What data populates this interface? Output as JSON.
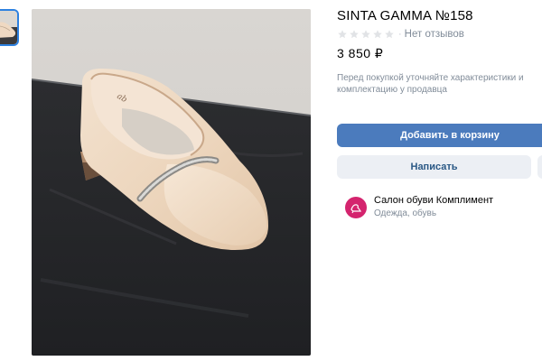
{
  "product": {
    "title": "SINTA GAMMA №158",
    "reviews_text": "Нет отзывов",
    "rating_stars_filled": 0,
    "rating_stars_total": 5,
    "price": "3 850 ₽",
    "note": "Перед покупкой уточняйте характеристики и комплектацию у продавца"
  },
  "actions": {
    "add_to_cart": "Добавить в корзину",
    "message": "Написать"
  },
  "seller": {
    "name": "Салон обуви Комплимент",
    "category": "Одежда, обувь"
  },
  "colors": {
    "accent": "#4b7bbd",
    "secondary_bg": "#eceff4",
    "secondary_text": "#2a5885",
    "muted_text": "#818c99",
    "avatar": "#d4246e",
    "thumb_border": "#2d81e0"
  },
  "icons": {
    "star": "star-outline-icon",
    "seller_logo": "shoe-logo-icon"
  }
}
